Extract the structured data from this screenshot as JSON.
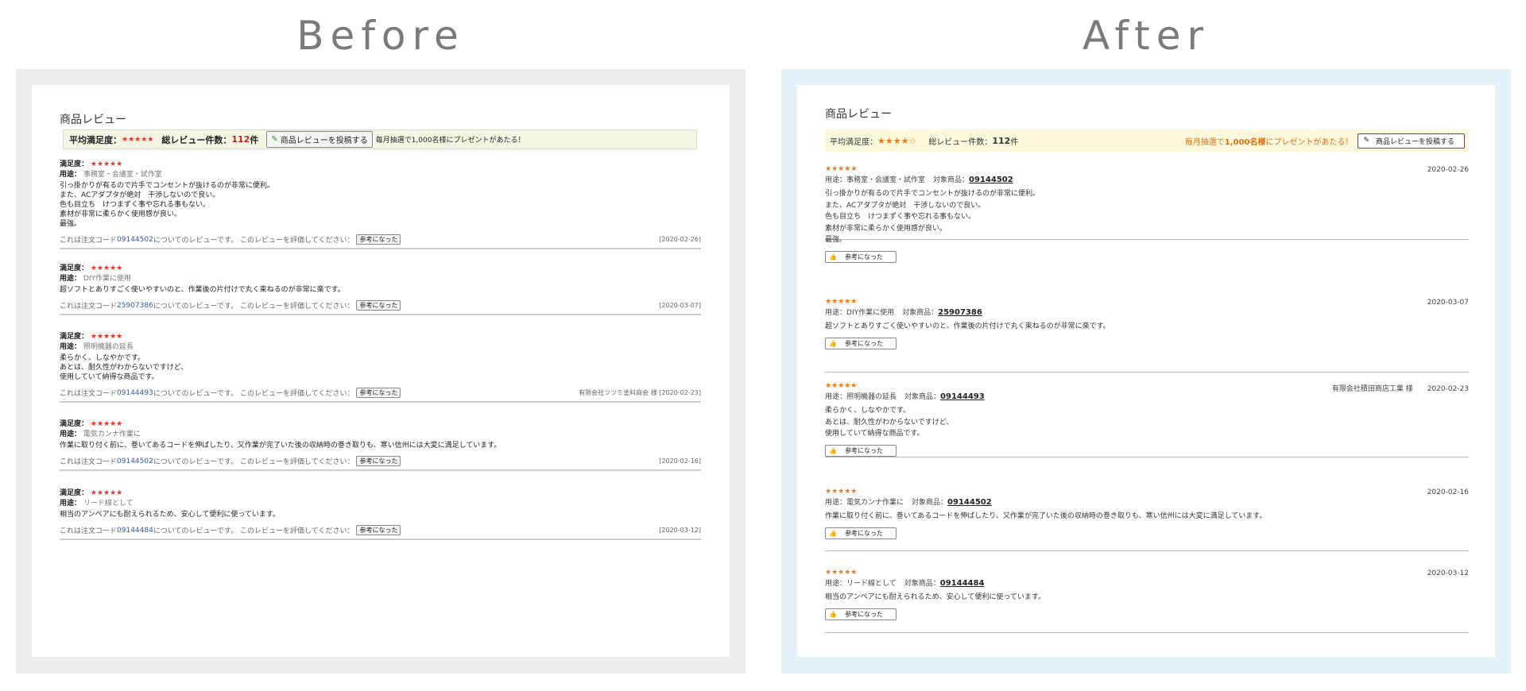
{
  "headings": {
    "before": "Before",
    "after": "After"
  },
  "before": {
    "title": "商品レビュー",
    "summary": {
      "avg_label": "平均満足度：",
      "stars": "★★★★★",
      "total_label": "総レビュー件数：",
      "total_count": "112",
      "total_unit": "件",
      "post_button": "商品レビューを投稿する",
      "promo": "毎月抽選で1,000名様にプレゼントがあたる！"
    },
    "labels": {
      "satisfaction": "満足度：",
      "use": "用途：",
      "footer_prefix": "これは注文コード",
      "footer_mid": "についてのレビューです。 このレビューを評価してください：",
      "helpful": "参考になった"
    },
    "reviews": [
      {
        "stars": "★★★★★",
        "use": "事務室・会議室・試作室",
        "text": "引っ掛かりが有るので片手でコンセントが抜けるのが非常に便利。\nまた、ACアダプタが絶対　干渉しないので良い。\n色も目立ち　けつまずく事や忘れる事もない。\n素材が非常に柔らかく使用感が良い。\n最強。",
        "code": "09144502",
        "right": "[2020-02-26]"
      },
      {
        "stars": "★★★★★",
        "use": "DIY作業に使用",
        "text": "超ソフトとありすごく使いやすいのと、作業後の片付けで丸く束ねるのが非常に楽です。",
        "code": "25907386",
        "right": "[2020-03-07]"
      },
      {
        "stars": "★★★★★",
        "use": "照明機器の延長",
        "text": "柔らかく、しなやかです。\nあとは、耐久性がわからないですけど、\n使用していて納得な商品です。",
        "code": "09144493",
        "right": "有限会社ツツミ塗料商会 様 [2020-02-23]"
      },
      {
        "stars": "★★★★★",
        "use": "電気カンナ作業に",
        "text": "作業に取り付く前に、巻いてあるコードを伸ばしたり、又作業が完了いた後の収納時の巻き取りも、寒い信州には大変に満足しています。",
        "code": "09144502",
        "right": "[2020-02-16]"
      },
      {
        "stars": "★★★★★",
        "use": "リード線として",
        "text": "相当のアンペアにも耐えられるため、安心して便利に使っています。",
        "code": "09144484",
        "right": "[2020-03-12]"
      }
    ]
  },
  "after": {
    "title": "商品レビュー",
    "summary": {
      "avg_label": "平均満足度：",
      "stars": "★★★★☆",
      "total_label": "総レビュー件数：",
      "total_count": "112",
      "total_unit": "件",
      "promo_a": "毎月抽選で",
      "promo_b": "1,000名様",
      "promo_c": "にプレゼントがあたる！",
      "post_button": "商品レビューを投稿する"
    },
    "labels": {
      "use": "用途：",
      "product": "対象商品：",
      "helpful": "参考になった"
    },
    "reviews": [
      {
        "stars": "★★★★★",
        "use": "事務室・会議室・試作室",
        "code": "09144502",
        "text": "引っ掛かりが有るので片手でコンセントが抜けるのが非常に便利。\nまた、ACアダプタが絶対　干渉しないので良い。\n色も目立ち　けつまずく事や忘れる事もない。\n素材が非常に柔らかく使用感が良い。\n最強。",
        "shop": "",
        "date": "2020-02-26"
      },
      {
        "stars": "★★★★★",
        "use": "DIY作業に使用",
        "code": "25907386",
        "text": "超ソフトとありすごく使いやすいのと、作業後の片付けで丸く束ねるのが非常に楽です。",
        "shop": "",
        "date": "2020-03-07"
      },
      {
        "stars": "★★★★★",
        "use": "照明機器の延長",
        "code": "09144493",
        "text": "柔らかく、しなやかです。\nあとは、耐久性がわからないですけど、\n使用していて納得な商品です。",
        "shop": "有限会社積田商店工業 様",
        "date": "2020-02-23"
      },
      {
        "stars": "★★★★★",
        "use": "電気カンナ作業に",
        "code": "09144502",
        "text": "作業に取り付く前に、巻いてあるコードを伸ばしたり、又作業が完了いた後の収納時の巻き取りも、寒い信州には大変に満足しています。",
        "shop": "",
        "date": "2020-02-16"
      },
      {
        "stars": "★★★★★",
        "use": "リード線として",
        "code": "09144484",
        "text": "相当のアンペアにも耐えられるため、安心して便利に使っています。",
        "shop": "",
        "date": "2020-03-12"
      }
    ]
  }
}
